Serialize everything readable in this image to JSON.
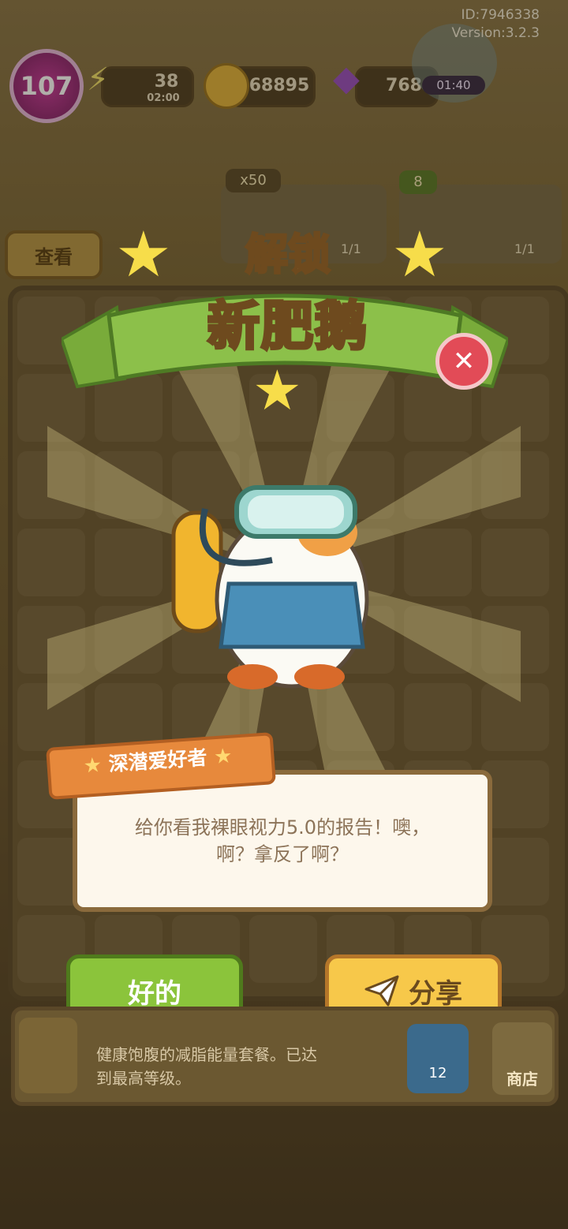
{
  "hud": {
    "level": "107",
    "energy": "38",
    "energy_timer": "02:00",
    "coins": "68895",
    "gems": "768",
    "chest_timer": "01:40",
    "id": "ID:7946338",
    "version": "Version:3.2.3"
  },
  "order_tags": {
    "coin_multiplier": "x50",
    "star_count": "8",
    "progress_a": "1/1",
    "progress_b": "1/1"
  },
  "view_button": "查看",
  "banner": {
    "line1": "解锁",
    "line2": "新肥鹅"
  },
  "dialog": {
    "name": "深潜爱好者",
    "text_line1": "给你看我裸眼视力5.0的报告！噢，",
    "text_line2": "啊？拿反了啊？"
  },
  "buttons": {
    "ok": "好的",
    "share": "分享"
  },
  "bottom": {
    "description_line1": "健康饱腹的减脂能量套餐。已达",
    "description_line2": "到最高等级。",
    "shop_label": "商店",
    "coin_count": "12"
  },
  "colors": {
    "ok_button": "#8bc43b",
    "share_button": "#f7c84a",
    "banner_green": "#8cc04a",
    "close_red": "#e24b57"
  },
  "icons": [
    "energy-icon",
    "coin-icon",
    "gem-icon",
    "chest-icon",
    "close-icon",
    "paper-plane-icon",
    "exit-icon",
    "shop-icon"
  ]
}
